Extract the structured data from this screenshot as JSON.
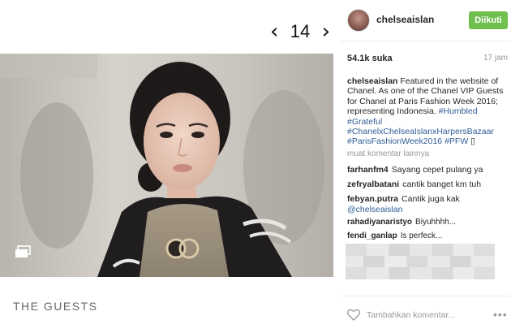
{
  "gallery": {
    "prev_icon": "chevron-left-icon",
    "next_icon": "chevron-right-icon",
    "counter": "14"
  },
  "article": {
    "section_title": "THE GUESTS"
  },
  "post": {
    "header_username": "chelseaislan",
    "follow_label": "Diikuti",
    "follow_color": "#70c050",
    "likes": "54.1k suka",
    "time": "17 jam",
    "caption": {
      "user": "chelseaislan",
      "text": "Featured in the website of Chanel. As one of the Chanel VIP Guests for Chanel at Paris Fashion Week 2016; representing Indonesia.",
      "tags": [
        "#Humbled",
        "#Grateful",
        "#ChanelxChelseaIslanxHarpersBazaar",
        "#ParisFashionWeek2016",
        "#PFW"
      ],
      "suffix": "▯"
    },
    "more_comments": "muat komentar lainnya",
    "comments": [
      {
        "user": "farhanfm4",
        "text": "Sayang cepet pulang ya"
      },
      {
        "user": "zefryalbatani",
        "text": "cantik banget km tuh"
      },
      {
        "user": "febyan.putra",
        "text": "Cantik juga kak",
        "mention": "@chelseaislan"
      },
      {
        "user": "rahadiyanaristyo",
        "text": "Biyuhhhh..."
      },
      {
        "user": "fendi_ganlap",
        "text": "Is perfeck..."
      }
    ],
    "comment_placeholder": "Tambahkan komentar...",
    "more_options": "•••",
    "tag_color": "#2f5e95"
  }
}
